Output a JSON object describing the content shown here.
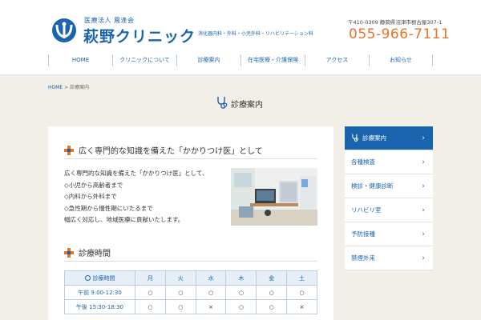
{
  "header": {
    "corp_name": "医療法人 鳳逢会",
    "clinic_name": "萩野クリニック",
    "departments": "消化器内科・外科・小児外科・リハビリテーション科",
    "address": "〒410-0309 静岡県沼津市根古屋307-1",
    "phone": "055-966-7111"
  },
  "nav": {
    "items": [
      {
        "label": "HOME"
      },
      {
        "label": "クリニックについて"
      },
      {
        "label": "診療案内"
      },
      {
        "label": "在宅医療・介護保険"
      },
      {
        "label": "アクセス"
      },
      {
        "label": "お知らせ"
      }
    ]
  },
  "breadcrumb": {
    "home": "HOME",
    "separator": ">",
    "current": "診療案内"
  },
  "page": {
    "title": "診療案内"
  },
  "main": {
    "section1_title": "広く専門的な知識を備えた「かかりつけ医」として",
    "body_lines": [
      "広く専門的な知識を備えた「かかりつけ医」として、",
      "◇小児から高齢者まで",
      "◇内科から外科まで",
      "◇急性期から慢性期にいたるまで",
      "幅広く対応し、地域医療に貢献いたします。"
    ],
    "section2_title": "診療時間"
  },
  "hours_table": {
    "header": [
      "診療時間",
      "月",
      "火",
      "水",
      "木",
      "金",
      "土"
    ],
    "rows": [
      {
        "time": "午前 9:00-12:30",
        "cells": [
          "○",
          "○",
          "○",
          "○",
          "○",
          "○"
        ]
      },
      {
        "time": "午後 15:30-18:30",
        "cells": [
          "○",
          "○",
          "×",
          "○",
          "○",
          "×"
        ]
      }
    ]
  },
  "sidebar": {
    "items": [
      {
        "label": "診療案内"
      },
      {
        "label": "各種検査"
      },
      {
        "label": "検診・健康診断"
      },
      {
        "label": "リハビリ室"
      },
      {
        "label": "予防接種"
      },
      {
        "label": "禁煙外来"
      }
    ],
    "chevron": "›"
  },
  "colors": {
    "brand_blue": "#1a64ad",
    "accent_orange": "#e8742a",
    "background": "#f2efe9"
  }
}
